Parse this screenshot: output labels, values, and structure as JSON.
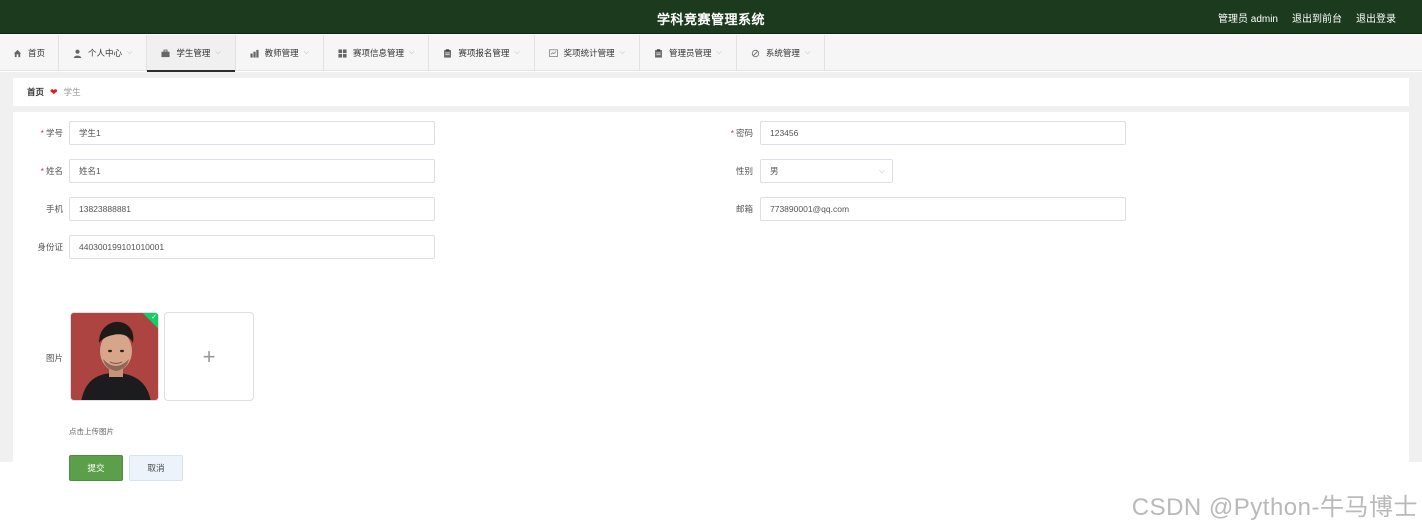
{
  "header": {
    "title": "学科竞赛管理系统",
    "user_label": "管理员 admin",
    "back_label": "退出到前台",
    "logout_label": "退出登录"
  },
  "nav": {
    "items": [
      {
        "label": "首页",
        "icon": "home-icon",
        "has_chevron": false
      },
      {
        "label": "个人中心",
        "icon": "user-icon",
        "has_chevron": true
      },
      {
        "label": "学生管理",
        "icon": "briefcase-icon",
        "has_chevron": true,
        "active": true
      },
      {
        "label": "教师管理",
        "icon": "chart-icon",
        "has_chevron": true
      },
      {
        "label": "赛项信息管理",
        "icon": "grid-icon",
        "has_chevron": true
      },
      {
        "label": "赛项报名管理",
        "icon": "clipboard-icon",
        "has_chevron": true
      },
      {
        "label": "奖项统计管理",
        "icon": "statistics-icon",
        "has_chevron": true
      },
      {
        "label": "管理员管理",
        "icon": "clipboard-icon",
        "has_chevron": true
      },
      {
        "label": "系统管理",
        "icon": "settings-icon",
        "has_chevron": true
      }
    ]
  },
  "breadcrumb": {
    "home": "首页",
    "current": "学生"
  },
  "form": {
    "student_id": {
      "label": "学号",
      "value": "学生1",
      "required": true
    },
    "password": {
      "label": "密码",
      "value": "123456",
      "required": true
    },
    "name": {
      "label": "姓名",
      "value": "姓名1",
      "required": true
    },
    "gender": {
      "label": "性别",
      "value": "男"
    },
    "phone": {
      "label": "手机",
      "value": "13823888881"
    },
    "email": {
      "label": "邮箱",
      "value": "773890001@qq.com"
    },
    "id_card": {
      "label": "身份证",
      "value": "440300199101010001"
    },
    "image": {
      "label": "图片",
      "tip": "点击上传图片"
    },
    "submit_label": "提交",
    "cancel_label": "取消"
  },
  "watermark": "CSDN @Python-牛马博士",
  "colors": {
    "header_bg": "#1b3a1e",
    "primary_button": "#5c9f4a",
    "required_mark": "#e24444"
  }
}
